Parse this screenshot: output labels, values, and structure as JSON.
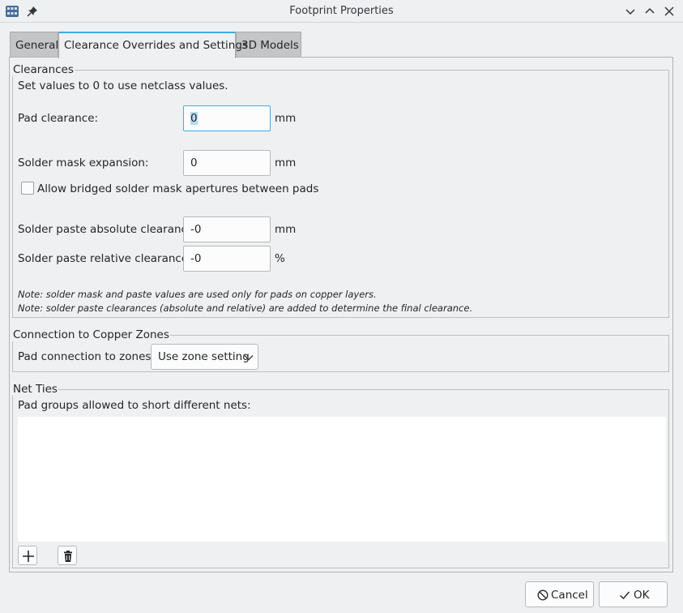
{
  "window": {
    "title": "Footprint Properties"
  },
  "tabs": [
    {
      "label": "General"
    },
    {
      "label": "Clearance Overrides and Settings"
    },
    {
      "label": "3D Models"
    }
  ],
  "clearances": {
    "group_title": "Clearances",
    "hint": "Set values to 0 to use netclass values.",
    "pad_clearance": {
      "label": "Pad clearance:",
      "value": "0",
      "unit": "mm"
    },
    "solder_mask": {
      "label": "Solder mask expansion:",
      "value": "0",
      "unit": "mm"
    },
    "bridged_apertures": {
      "label": "Allow bridged solder mask apertures between pads",
      "checked": false
    },
    "paste_absolute": {
      "label": "Solder paste absolute clearance:",
      "value": "-0",
      "unit": "mm"
    },
    "paste_relative": {
      "label": "Solder paste relative clearance:",
      "value": "-0",
      "unit": "%"
    },
    "note1": "Note: solder mask and paste values are used only for pads on copper layers.",
    "note2": "Note: solder paste clearances (absolute and relative) are added to determine the final clearance."
  },
  "zones": {
    "group_title": "Connection to Copper Zones",
    "label": "Pad connection to zones:",
    "selected": "Use zone setting"
  },
  "net_ties": {
    "group_title": "Net Ties",
    "label": "Pad groups allowed to short different nets:",
    "items": []
  },
  "buttons": {
    "cancel": "Cancel",
    "ok": "OK"
  },
  "colors": {
    "accent": "#3daee9",
    "window_bg": "#eff0f1"
  }
}
